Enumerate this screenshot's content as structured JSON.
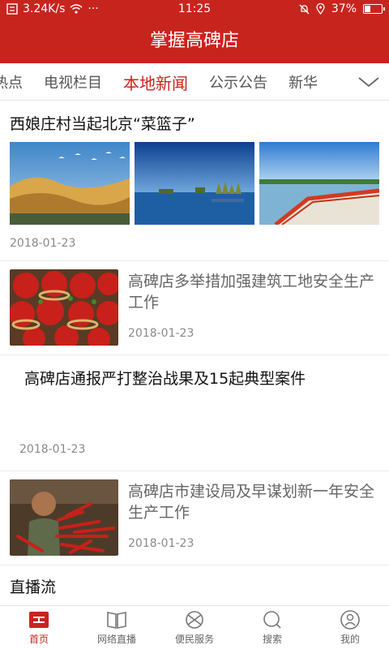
{
  "status": {
    "speed": "3.24K/s",
    "dots": "···",
    "time": "11:25",
    "battery": "37%",
    "battery_level": 0.37
  },
  "app": {
    "title": "掌握高碑店"
  },
  "tabs": [
    {
      "label": "热点"
    },
    {
      "label": "电视栏目"
    },
    {
      "label": "本地新闻",
      "active": true
    },
    {
      "label": "公示公告"
    },
    {
      "label": "新华"
    }
  ],
  "news": [
    {
      "title": "西娘庄村当起北京“菜篮子”",
      "date": "2018-01-23"
    },
    {
      "title": "高碑店多举措加强建筑工地安全生产工作",
      "date": "2018-01-23"
    },
    {
      "title": "高碑店通报严打整治战果及15起典型案件",
      "date": "2018-01-23"
    },
    {
      "title": "高碑店市建设局及早谋划新一年安全生产工作",
      "date": "2018-01-23"
    }
  ],
  "section": {
    "title": "直播流"
  },
  "nav": [
    {
      "label": "首页",
      "icon": "home-icon",
      "active": true
    },
    {
      "label": "网络直播",
      "icon": "book-icon"
    },
    {
      "label": "便民服务",
      "icon": "service-icon"
    },
    {
      "label": "搜索",
      "icon": "search-icon"
    },
    {
      "label": "我的",
      "icon": "profile-icon"
    }
  ],
  "colors": {
    "brand": "#c8241e"
  }
}
